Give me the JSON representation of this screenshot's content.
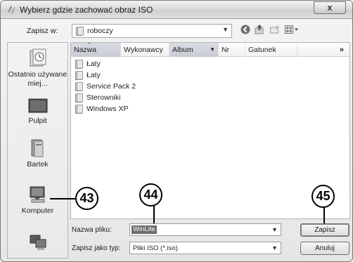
{
  "window": {
    "title": "Wybierz gdzie zachować obraz ISO",
    "close_label": "x"
  },
  "toolbar": {
    "save_in_label": "Zapisz w:",
    "location": "roboczy",
    "icons": [
      "back-icon",
      "up-folder-icon",
      "new-folder-icon",
      "views-menu-icon"
    ]
  },
  "places": [
    {
      "label": "Ostatnio używane miej...",
      "icon": "recent-places-icon"
    },
    {
      "label": "Pulpit",
      "icon": "desktop-icon"
    },
    {
      "label": "Bartek",
      "icon": "user-folder-icon"
    },
    {
      "label": "Komputer",
      "icon": "computer-icon"
    },
    {
      "label": "",
      "icon": "network-icon"
    }
  ],
  "file_list": {
    "columns": [
      "Nazwa",
      "Wykonawcy",
      "Album",
      "Nr",
      "Gatunek"
    ],
    "more": "»",
    "items": [
      "Łaty",
      "Łaty",
      "Service Pack 2",
      "Sterowniki",
      "Windows XP"
    ]
  },
  "bottom": {
    "filename_label": "Nazwa pliku:",
    "filename_value": "WinLite",
    "filetype_label": "Zapisz jako typ:",
    "filetype_value": "Pliki ISO (*.iso)",
    "save_button": "Zapisz",
    "cancel_button": "Anuluj"
  },
  "callouts": [
    "43",
    "44",
    "45"
  ]
}
